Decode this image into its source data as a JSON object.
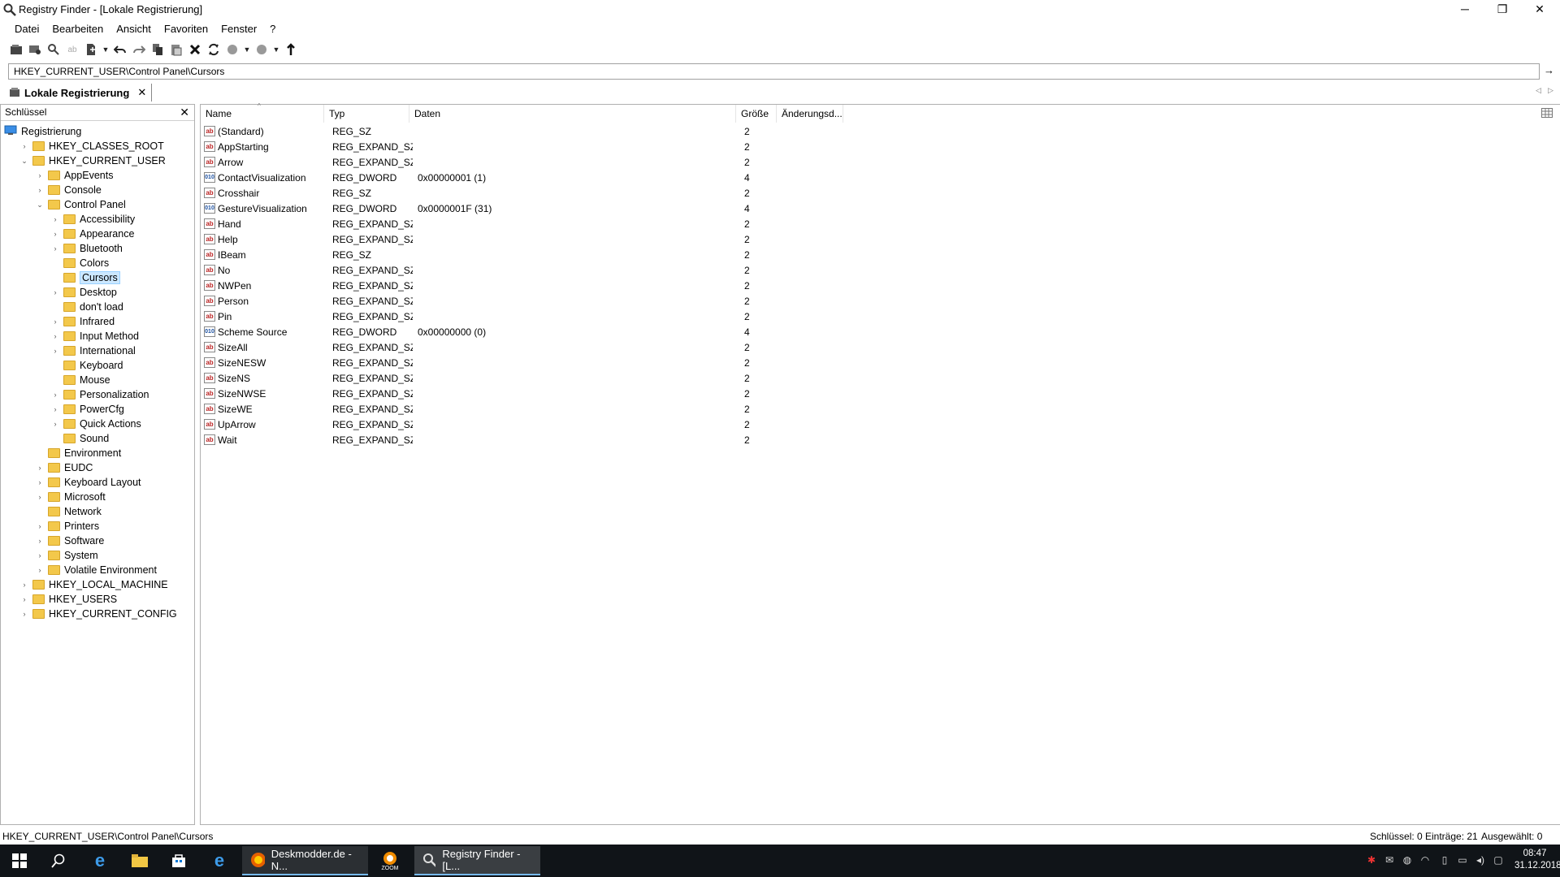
{
  "window": {
    "title": "Registry Finder - [Lokale Registrierung]"
  },
  "menu": [
    "Datei",
    "Bearbeiten",
    "Ansicht",
    "Favoriten",
    "Fenster",
    "?"
  ],
  "address": {
    "value": "HKEY_CURRENT_USER\\Control Panel\\Cursors"
  },
  "tab": {
    "label": "Lokale Registrierung"
  },
  "tree": {
    "header": "Schlüssel",
    "items": [
      {
        "label": "Registrierung",
        "level": 0,
        "expander": "",
        "icon": "computer"
      },
      {
        "label": "HKEY_CLASSES_ROOT",
        "level": 1,
        "expander": "›"
      },
      {
        "label": "HKEY_CURRENT_USER",
        "level": 1,
        "expander": "⌄"
      },
      {
        "label": "AppEvents",
        "level": 2,
        "expander": "›"
      },
      {
        "label": "Console",
        "level": 2,
        "expander": "›"
      },
      {
        "label": "Control Panel",
        "level": 2,
        "expander": "⌄"
      },
      {
        "label": "Accessibility",
        "level": 3,
        "expander": "›"
      },
      {
        "label": "Appearance",
        "level": 3,
        "expander": "›"
      },
      {
        "label": "Bluetooth",
        "level": 3,
        "expander": "›"
      },
      {
        "label": "Colors",
        "level": 3,
        "expander": ""
      },
      {
        "label": "Cursors",
        "level": 3,
        "expander": "",
        "selected": true
      },
      {
        "label": "Desktop",
        "level": 3,
        "expander": "›"
      },
      {
        "label": "don't load",
        "level": 3,
        "expander": ""
      },
      {
        "label": "Infrared",
        "level": 3,
        "expander": "›"
      },
      {
        "label": "Input Method",
        "level": 3,
        "expander": "›"
      },
      {
        "label": "International",
        "level": 3,
        "expander": "›"
      },
      {
        "label": "Keyboard",
        "level": 3,
        "expander": ""
      },
      {
        "label": "Mouse",
        "level": 3,
        "expander": ""
      },
      {
        "label": "Personalization",
        "level": 3,
        "expander": "›"
      },
      {
        "label": "PowerCfg",
        "level": 3,
        "expander": "›"
      },
      {
        "label": "Quick Actions",
        "level": 3,
        "expander": "›"
      },
      {
        "label": "Sound",
        "level": 3,
        "expander": ""
      },
      {
        "label": "Environment",
        "level": 2,
        "expander": ""
      },
      {
        "label": "EUDC",
        "level": 2,
        "expander": "›"
      },
      {
        "label": "Keyboard Layout",
        "level": 2,
        "expander": "›"
      },
      {
        "label": "Microsoft",
        "level": 2,
        "expander": "›"
      },
      {
        "label": "Network",
        "level": 2,
        "expander": ""
      },
      {
        "label": "Printers",
        "level": 2,
        "expander": "›"
      },
      {
        "label": "Software",
        "level": 2,
        "expander": "›"
      },
      {
        "label": "System",
        "level": 2,
        "expander": "›"
      },
      {
        "label": "Volatile Environment",
        "level": 2,
        "expander": "›"
      },
      {
        "label": "HKEY_LOCAL_MACHINE",
        "level": 1,
        "expander": "›"
      },
      {
        "label": "HKEY_USERS",
        "level": 1,
        "expander": "›"
      },
      {
        "label": "HKEY_CURRENT_CONFIG",
        "level": 1,
        "expander": "›"
      }
    ]
  },
  "list": {
    "columns": [
      "Name",
      "Typ",
      "Daten",
      "Größe",
      "Änderungsd..."
    ],
    "rows": [
      {
        "name": "(Standard)",
        "type": "REG_SZ",
        "data": "",
        "size": "2",
        "kind": "sz"
      },
      {
        "name": "AppStarting",
        "type": "REG_EXPAND_SZ",
        "data": "",
        "size": "2",
        "kind": "sz"
      },
      {
        "name": "Arrow",
        "type": "REG_EXPAND_SZ",
        "data": "",
        "size": "2",
        "kind": "sz"
      },
      {
        "name": "ContactVisualization",
        "type": "REG_DWORD",
        "data": "0x00000001 (1)",
        "size": "4",
        "kind": "dw"
      },
      {
        "name": "Crosshair",
        "type": "REG_SZ",
        "data": "",
        "size": "2",
        "kind": "sz"
      },
      {
        "name": "GestureVisualization",
        "type": "REG_DWORD",
        "data": "0x0000001F (31)",
        "size": "4",
        "kind": "dw"
      },
      {
        "name": "Hand",
        "type": "REG_EXPAND_SZ",
        "data": "",
        "size": "2",
        "kind": "sz"
      },
      {
        "name": "Help",
        "type": "REG_EXPAND_SZ",
        "data": "",
        "size": "2",
        "kind": "sz"
      },
      {
        "name": "IBeam",
        "type": "REG_SZ",
        "data": "",
        "size": "2",
        "kind": "sz"
      },
      {
        "name": "No",
        "type": "REG_EXPAND_SZ",
        "data": "",
        "size": "2",
        "kind": "sz"
      },
      {
        "name": "NWPen",
        "type": "REG_EXPAND_SZ",
        "data": "",
        "size": "2",
        "kind": "sz"
      },
      {
        "name": "Person",
        "type": "REG_EXPAND_SZ",
        "data": "",
        "size": "2",
        "kind": "sz"
      },
      {
        "name": "Pin",
        "type": "REG_EXPAND_SZ",
        "data": "",
        "size": "2",
        "kind": "sz"
      },
      {
        "name": "Scheme Source",
        "type": "REG_DWORD",
        "data": "0x00000000 (0)",
        "size": "4",
        "kind": "dw"
      },
      {
        "name": "SizeAll",
        "type": "REG_EXPAND_SZ",
        "data": "",
        "size": "2",
        "kind": "sz"
      },
      {
        "name": "SizeNESW",
        "type": "REG_EXPAND_SZ",
        "data": "",
        "size": "2",
        "kind": "sz"
      },
      {
        "name": "SizeNS",
        "type": "REG_EXPAND_SZ",
        "data": "",
        "size": "2",
        "kind": "sz"
      },
      {
        "name": "SizeNWSE",
        "type": "REG_EXPAND_SZ",
        "data": "",
        "size": "2",
        "kind": "sz"
      },
      {
        "name": "SizeWE",
        "type": "REG_EXPAND_SZ",
        "data": "",
        "size": "2",
        "kind": "sz"
      },
      {
        "name": "UpArrow",
        "type": "REG_EXPAND_SZ",
        "data": "",
        "size": "2",
        "kind": "sz"
      },
      {
        "name": "Wait",
        "type": "REG_EXPAND_SZ",
        "data": "",
        "size": "2",
        "kind": "sz"
      }
    ]
  },
  "status": {
    "path": "HKEY_CURRENT_USER\\Control Panel\\Cursors",
    "keys": "Schlüssel: 0",
    "entries": "Einträge: 21",
    "selected": "Ausgewählt: 0"
  },
  "taskbar": {
    "apps": [
      {
        "label": "Deskmodder.de - N..."
      },
      {
        "label": "ZOOM"
      },
      {
        "label": "Registry Finder - [L..."
      }
    ],
    "time": "08:47",
    "date": "31.12.2018"
  },
  "icons": {
    "sz_badge": "ab",
    "dword_badge": "010",
    "minimize": "─",
    "restore": "❐",
    "close": "✕",
    "go": "→"
  }
}
